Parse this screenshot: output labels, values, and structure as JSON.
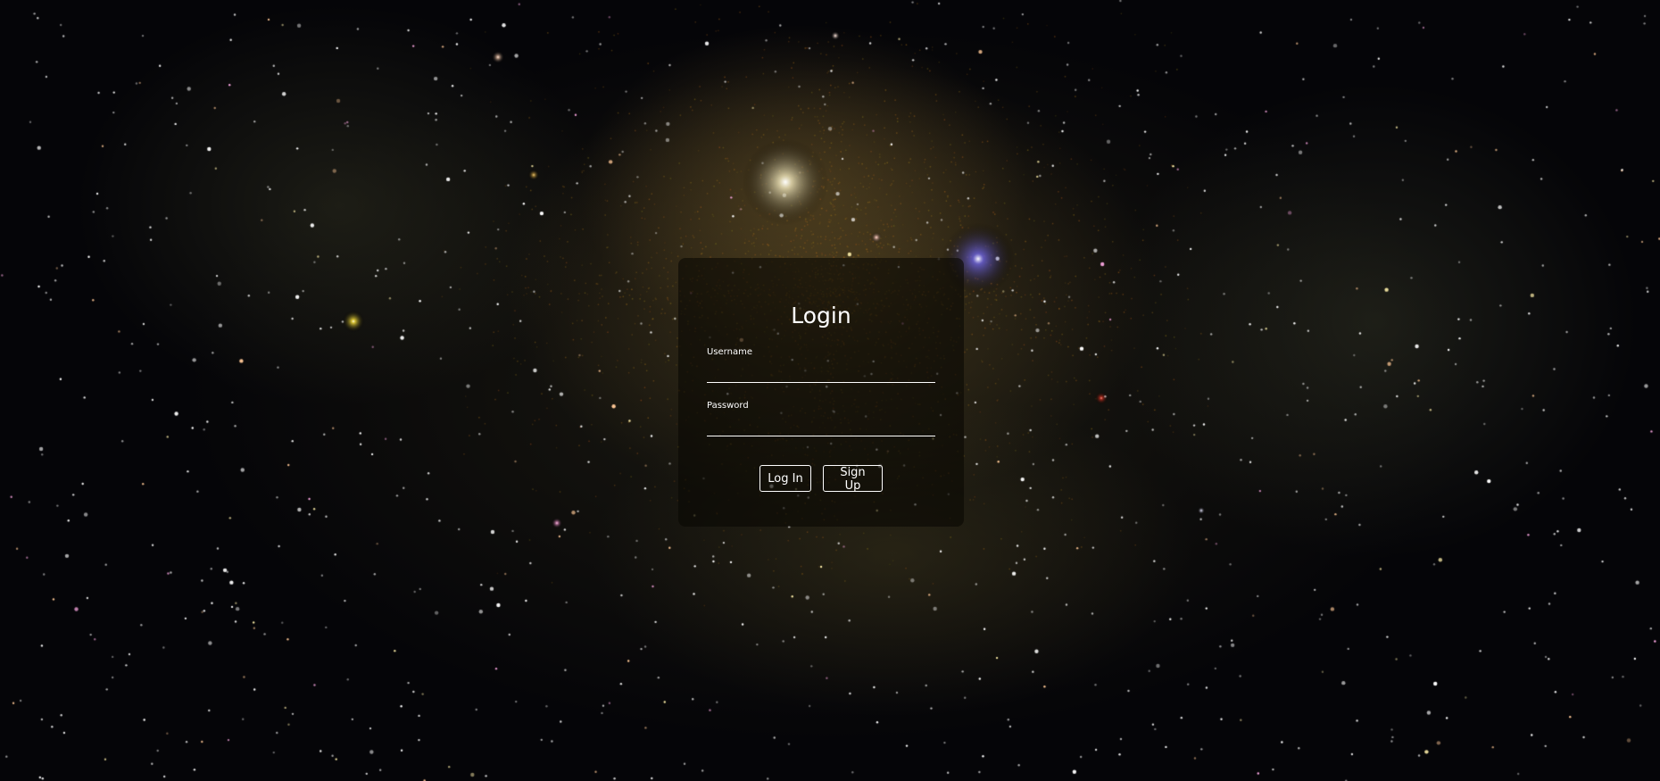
{
  "login": {
    "title": "Login",
    "username": {
      "label": "Username",
      "value": "",
      "placeholder": ""
    },
    "password": {
      "label": "Password",
      "value": "",
      "placeholder": ""
    },
    "buttons": {
      "login_label": "Log In",
      "signup_label": "Sign Up"
    }
  },
  "colors": {
    "text": "#ffffff",
    "card_background": "rgba(10,8,4,0.62)",
    "space_background": "#05050a"
  }
}
